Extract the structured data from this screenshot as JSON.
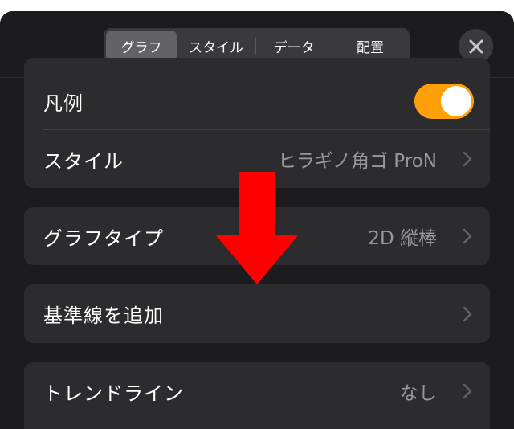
{
  "tabs": [
    {
      "label": "グラフ",
      "active": true
    },
    {
      "label": "スタイル",
      "active": false
    },
    {
      "label": "データ",
      "active": false
    },
    {
      "label": "配置",
      "active": false
    }
  ],
  "close_icon": "close-x-icon",
  "rows": {
    "legend": {
      "label": "凡例",
      "toggle_on": true
    },
    "style": {
      "label": "スタイル",
      "value": "ヒラギノ角ゴ ProN"
    },
    "chart_type": {
      "label": "グラフタイプ",
      "value": "2D 縦棒"
    },
    "add_baseline": {
      "label": "基準線を追加"
    },
    "trendline": {
      "label": "トレンドライン",
      "value": "なし"
    }
  },
  "colors": {
    "accent_toggle": "#ff9f0a",
    "annotation_arrow": "#ff0000"
  }
}
